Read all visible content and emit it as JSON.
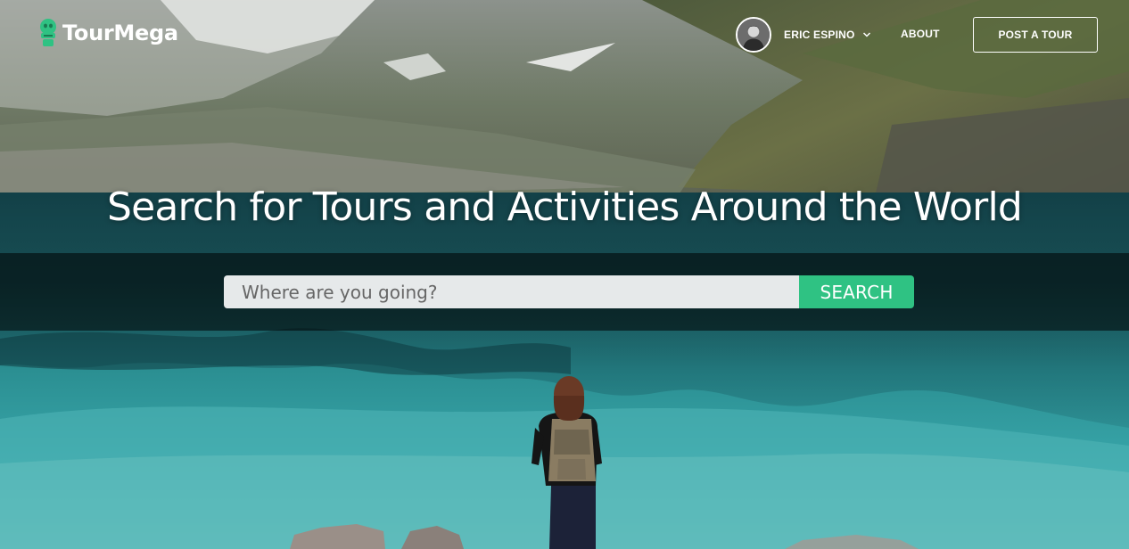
{
  "brand": {
    "name": "TourMega",
    "icon": "tourmega-logo-icon",
    "color": "#2fc283"
  },
  "header": {
    "user": {
      "name": "ERIC ESPINO",
      "avatar": "user-avatar",
      "menu_icon": "chevron-down-icon"
    },
    "nav": {
      "about": "ABOUT",
      "post_tour": "POST A TOUR"
    }
  },
  "hero": {
    "headline": "Search for Tours and Activities Around the World",
    "search": {
      "placeholder": "Where are you going?",
      "value": "",
      "button_label": "SEARCH"
    }
  },
  "colors": {
    "accent": "#2fc283",
    "search_field": "#e6e9ea",
    "band_overlay": "rgba(0,0,0,0.55)"
  }
}
